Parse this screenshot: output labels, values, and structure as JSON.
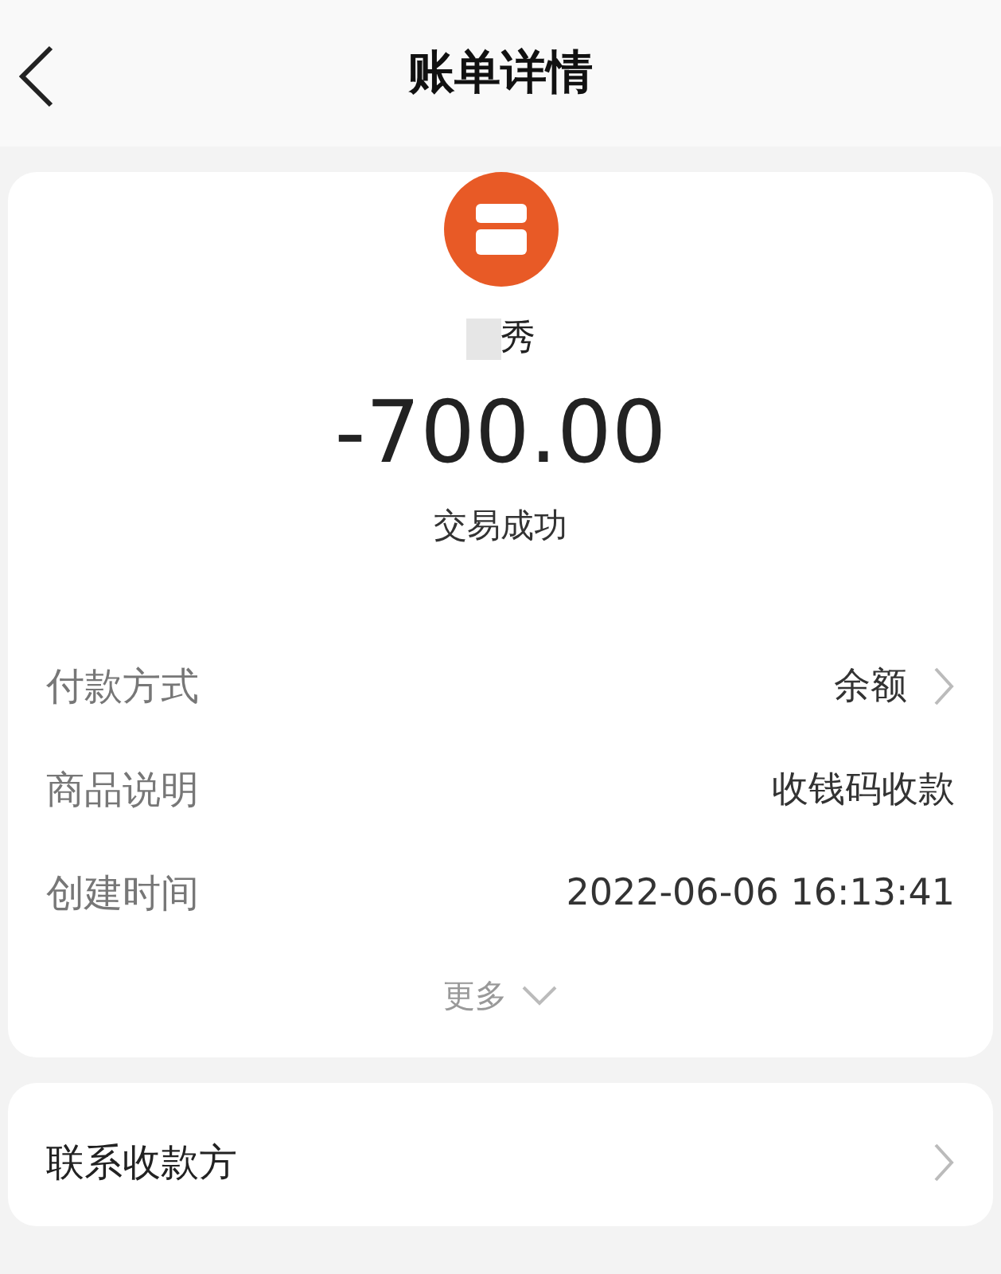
{
  "header": {
    "title": "账单详情"
  },
  "summary": {
    "payee": "秀",
    "amount": "-700.00",
    "status": "交易成功"
  },
  "details": [
    {
      "label": "付款方式",
      "value": "余额",
      "arrow": true
    },
    {
      "label": "商品说明",
      "value": "收钱码收款",
      "arrow": false
    },
    {
      "label": "创建时间",
      "value": "2022-06-06 16:13:41",
      "arrow": false
    }
  ],
  "more": "更多",
  "actions": [
    {
      "label": "联系收款方",
      "arrow": true
    }
  ]
}
